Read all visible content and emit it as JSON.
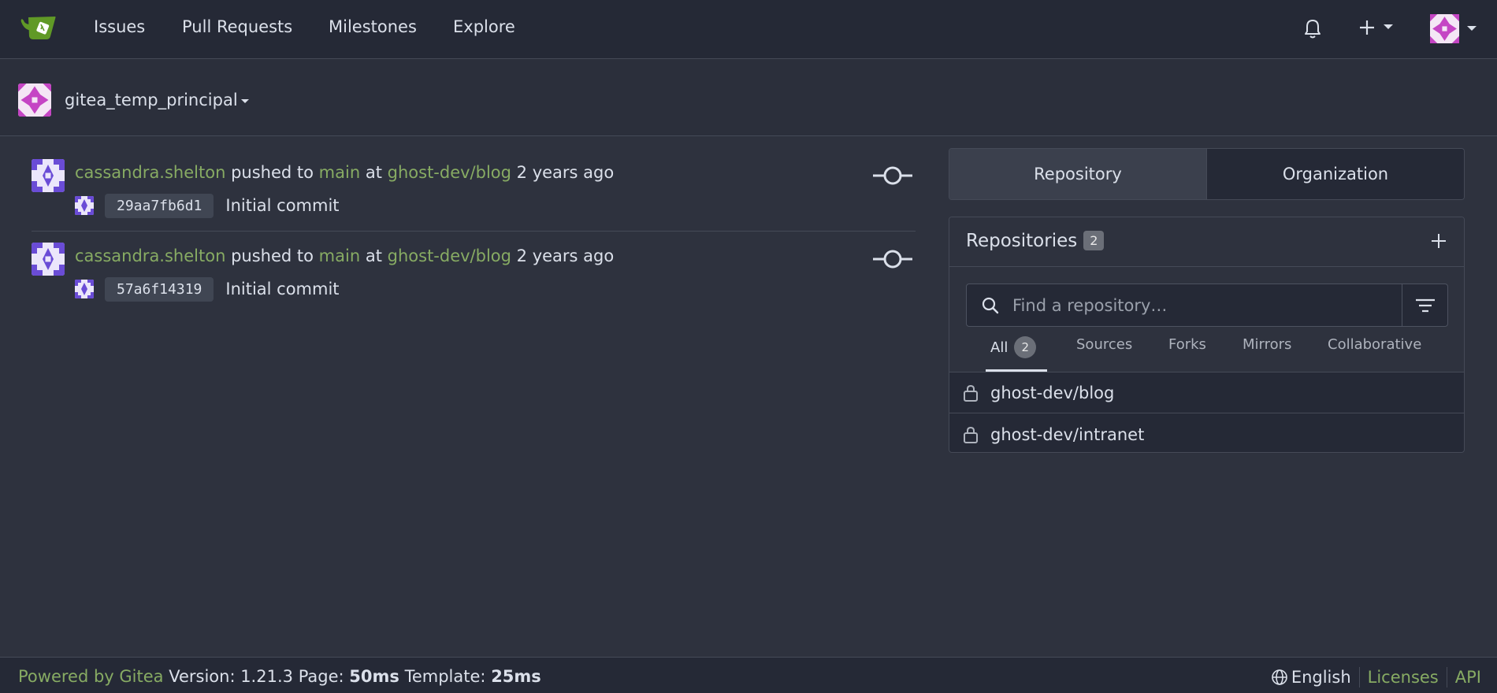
{
  "navbar": {
    "links": [
      "Issues",
      "Pull Requests",
      "Milestones",
      "Explore"
    ],
    "icons": [
      "gitea-logo-icon",
      "bell-icon",
      "plus-icon",
      "avatar"
    ]
  },
  "context": {
    "user": "gitea_temp_principal"
  },
  "feed": [
    {
      "user": "cassandra.shelton",
      "action": "pushed to",
      "branch": "main",
      "at": "at",
      "repo": "ghost-dev/blog",
      "time": "2 years ago",
      "sha": "29aa7fb6d1",
      "message": "Initial commit"
    },
    {
      "user": "cassandra.shelton",
      "action": "pushed to",
      "branch": "main",
      "at": "at",
      "repo": "ghost-dev/blog",
      "time": "2 years ago",
      "sha": "57a6f14319",
      "message": "Initial commit"
    }
  ],
  "switcher": {
    "repository": "Repository",
    "organization": "Organization"
  },
  "repos": {
    "title": "Repositories",
    "count": "2",
    "search_placeholder": "Find a repository…",
    "tabs": {
      "all": "All",
      "all_count": "2",
      "sources": "Sources",
      "forks": "Forks",
      "mirrors": "Mirrors",
      "collaborative": "Collaborative"
    },
    "items": [
      "ghost-dev/blog",
      "ghost-dev/intranet"
    ]
  },
  "footer": {
    "powered": "Powered by Gitea",
    "version": "Version: 1.21.3",
    "page_label": "Page:",
    "page_time": "50ms",
    "template_label": "Template:",
    "template_time": "25ms",
    "language": "English",
    "licenses": "Licenses",
    "api": "API"
  },
  "colors": {
    "accent": "#87ab63",
    "background": "#2e323e",
    "navbar": "#252936"
  }
}
